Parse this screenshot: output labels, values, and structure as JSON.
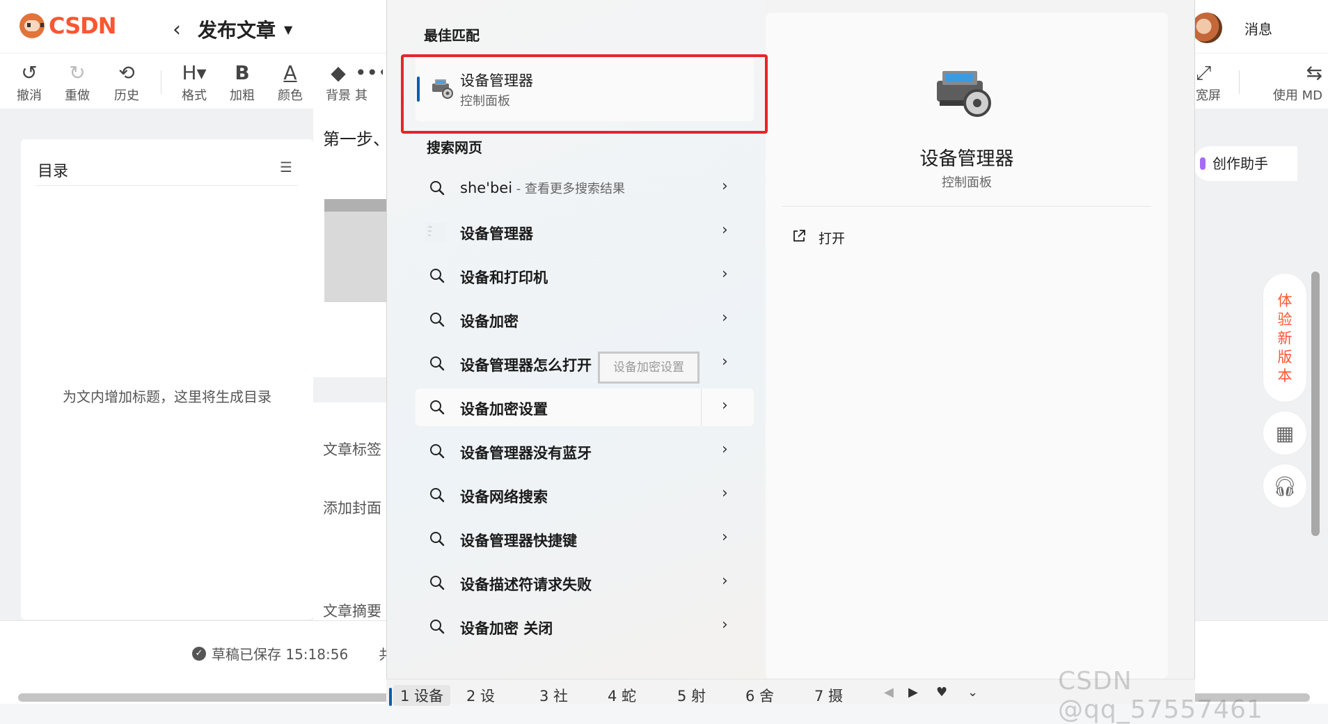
{
  "csdn": {
    "logo_text": "CSDN",
    "page_title": "发布文章",
    "messages_label": "消息",
    "toolbar": [
      {
        "label": "撤消",
        "icon": "undo-icon",
        "glyph": "↺"
      },
      {
        "label": "重做",
        "icon": "redo-icon",
        "glyph": "↻"
      },
      {
        "label": "历史",
        "icon": "history-icon",
        "glyph": "⟲"
      },
      {
        "label": "格式",
        "icon": "heading-icon",
        "glyph": "H▾"
      },
      {
        "label": "加粗",
        "icon": "bold-icon",
        "glyph": "B"
      },
      {
        "label": "颜色",
        "icon": "font-color-icon",
        "glyph": "A"
      },
      {
        "label": "背景",
        "icon": "paint-bucket-icon",
        "glyph": "◆"
      },
      {
        "label": "其",
        "icon": "more-icon",
        "glyph": "•••"
      }
    ],
    "toolbar_right": [
      {
        "label": "宽屏",
        "icon": "widescreen-icon",
        "glyph": "⤢"
      },
      {
        "label": "使用 MD",
        "icon": "switch-md-icon",
        "glyph": "⇆"
      }
    ],
    "toc": {
      "title": "目录",
      "empty_text": "为文内增加标题，这里将生成目录"
    },
    "editor": {
      "step_text": "第一步、",
      "tag_label": "文章标签",
      "cover_label": "添加封面",
      "summary_label": "文章摘要"
    },
    "draft_status": "草稿已保存 15:18:56",
    "draft_extra": "共",
    "assistant_label": "创作助手",
    "try_new_version": "体验新版本",
    "watermark": "CSDN @qq_57557461"
  },
  "search": {
    "best_match_heading": "最佳匹配",
    "best_match": {
      "title": "设备管理器",
      "subtitle": "控制面板"
    },
    "web_heading": "搜索网页",
    "results": [
      {
        "query": "she'bei",
        "hint": " - 查看更多搜索结果",
        "icon": "search-icon"
      },
      {
        "query": "设备管理器",
        "hint": "",
        "icon": "web-thumb-icon"
      },
      {
        "query": "设备和打印机",
        "hint": "",
        "icon": "search-icon"
      },
      {
        "query": "设备加密",
        "hint": "",
        "icon": "search-icon"
      },
      {
        "query": "设备管理器怎么打开",
        "hint": "",
        "icon": "search-icon"
      },
      {
        "query": "设备加密设置",
        "hint": "",
        "icon": "search-icon"
      },
      {
        "query": "设备管理器没有蓝牙",
        "hint": "",
        "icon": "search-icon"
      },
      {
        "query": "设备网络搜索",
        "hint": "",
        "icon": "search-icon"
      },
      {
        "query": "设备管理器快捷键",
        "hint": "",
        "icon": "search-icon"
      },
      {
        "query": "设备描述符请求失败",
        "hint": "",
        "icon": "search-icon"
      },
      {
        "query": "设备加密 关闭",
        "hint": "",
        "icon": "search-icon"
      }
    ],
    "tooltip": "设备加密设置",
    "detail": {
      "title": "设备管理器",
      "subtitle": "控制面板",
      "open_label": "打开"
    }
  },
  "ime": {
    "candidates": [
      "1 设备",
      "2 设",
      "3 社",
      "4 蛇",
      "5 射",
      "6 舍",
      "7 摄"
    ],
    "selected_index": 0
  },
  "colors": {
    "csdn_brand": "#fc5531",
    "highlight_box": "#e8232a",
    "accent_blue": "#0b5cad"
  }
}
